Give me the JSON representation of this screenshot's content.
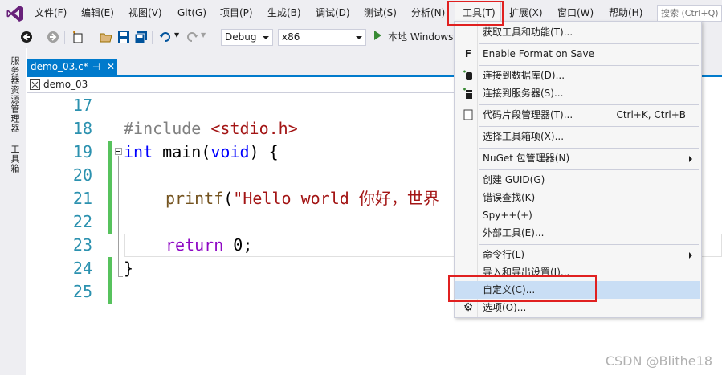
{
  "menubar": {
    "items": [
      "文件(F)",
      "编辑(E)",
      "视图(V)",
      "Git(G)",
      "项目(P)",
      "生成(B)",
      "调试(D)",
      "测试(S)",
      "分析(N)",
      "工具(T)",
      "扩展(X)",
      "窗口(W)",
      "帮助(H)"
    ],
    "search_placeholder": "搜索 (Ctrl+Q)"
  },
  "toolbar": {
    "configuration": "Debug",
    "platform": "x86",
    "run_label": "本地 Windows"
  },
  "side_strip": {
    "items": [
      "服务器资源管理器",
      "工具箱"
    ]
  },
  "document": {
    "tab_title": "demo_03.c*",
    "nav_scope": "demo_03"
  },
  "editor": {
    "lines": [
      {
        "num": "17"
      },
      {
        "num": "18",
        "t1": "#include ",
        "t2": "<stdio.h>"
      },
      {
        "num": "19",
        "t1": "int",
        "t2": " main(",
        "t3": "void",
        "t4": ") {"
      },
      {
        "num": "20"
      },
      {
        "num": "21",
        "t1": "printf",
        "t2": "(",
        "t3": "\"Hello world 你好，世界",
        "t4": ""
      },
      {
        "num": "22"
      },
      {
        "num": "23",
        "t1": "return",
        "t2": " 0;"
      },
      {
        "num": "24",
        "t1": "}"
      },
      {
        "num": "25"
      }
    ]
  },
  "tools_menu": {
    "items": [
      {
        "label": "获取工具和功能(T)...",
        "shortcut": ""
      },
      {
        "label": "Enable Format on Save",
        "shortcut": "",
        "icon": "F"
      },
      {
        "label": "连接到数据库(D)...",
        "shortcut": ""
      },
      {
        "label": "连接到服务器(S)...",
        "shortcut": ""
      },
      {
        "label": "代码片段管理器(T)...",
        "shortcut": "Ctrl+K, Ctrl+B"
      },
      {
        "label": "选择工具箱项(X)...",
        "shortcut": ""
      },
      {
        "label": "NuGet 包管理器(N)",
        "shortcut": ""
      },
      {
        "label": "创建 GUID(G)",
        "shortcut": ""
      },
      {
        "label": "错误查找(K)",
        "shortcut": ""
      },
      {
        "label": "Spy++(+)",
        "shortcut": ""
      },
      {
        "label": "外部工具(E)...",
        "shortcut": ""
      },
      {
        "label": "命令行(L)",
        "shortcut": ""
      },
      {
        "label": "导入和导出设置(I)...",
        "shortcut": ""
      },
      {
        "label": "自定义(C)...",
        "shortcut": ""
      },
      {
        "label": "选项(O)...",
        "shortcut": ""
      }
    ]
  },
  "watermark": "CSDN @Blithe18",
  "colors": {
    "accent": "#007acc",
    "highlight": "#c9def5",
    "annotation_red": "#e02020",
    "change_bar": "#57c25d"
  }
}
